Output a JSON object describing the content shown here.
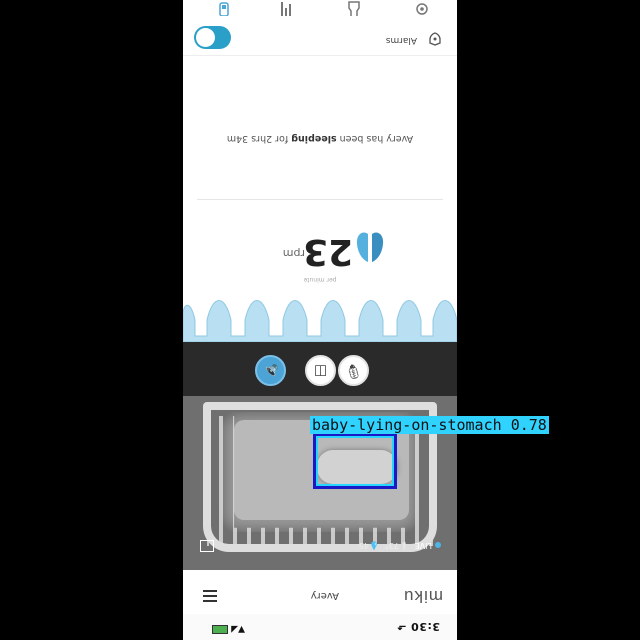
{
  "status_bar": {
    "time": "3:30",
    "time_suffix": "⬏",
    "icons": "▼◢"
  },
  "header": {
    "brand": "miku",
    "baby_name": "Avery"
  },
  "camera": {
    "live_label": "LIVE",
    "temperature": "73°",
    "humidity": "45"
  },
  "controls": {
    "speaker": "speaker-icon",
    "snapshot": "camera-icon",
    "mic": "mic-off-icon"
  },
  "breathing": {
    "rate_label": "per minute",
    "rate_value": "23",
    "rate_unit": "rpm"
  },
  "sleep": {
    "prefix": "Avery has been ",
    "state": "sleeping",
    "suffix": " for 2hrs 34m"
  },
  "alarms": {
    "label": "Alarms",
    "enabled": true
  },
  "colors": {
    "accent": "#2a9fc7",
    "wave": "#9fd4ec",
    "box_outer": "#1919c8",
    "box_inner": "#27d6ff"
  },
  "detection": {
    "label": "baby-lying-on-stomach",
    "confidence": "0.78"
  }
}
